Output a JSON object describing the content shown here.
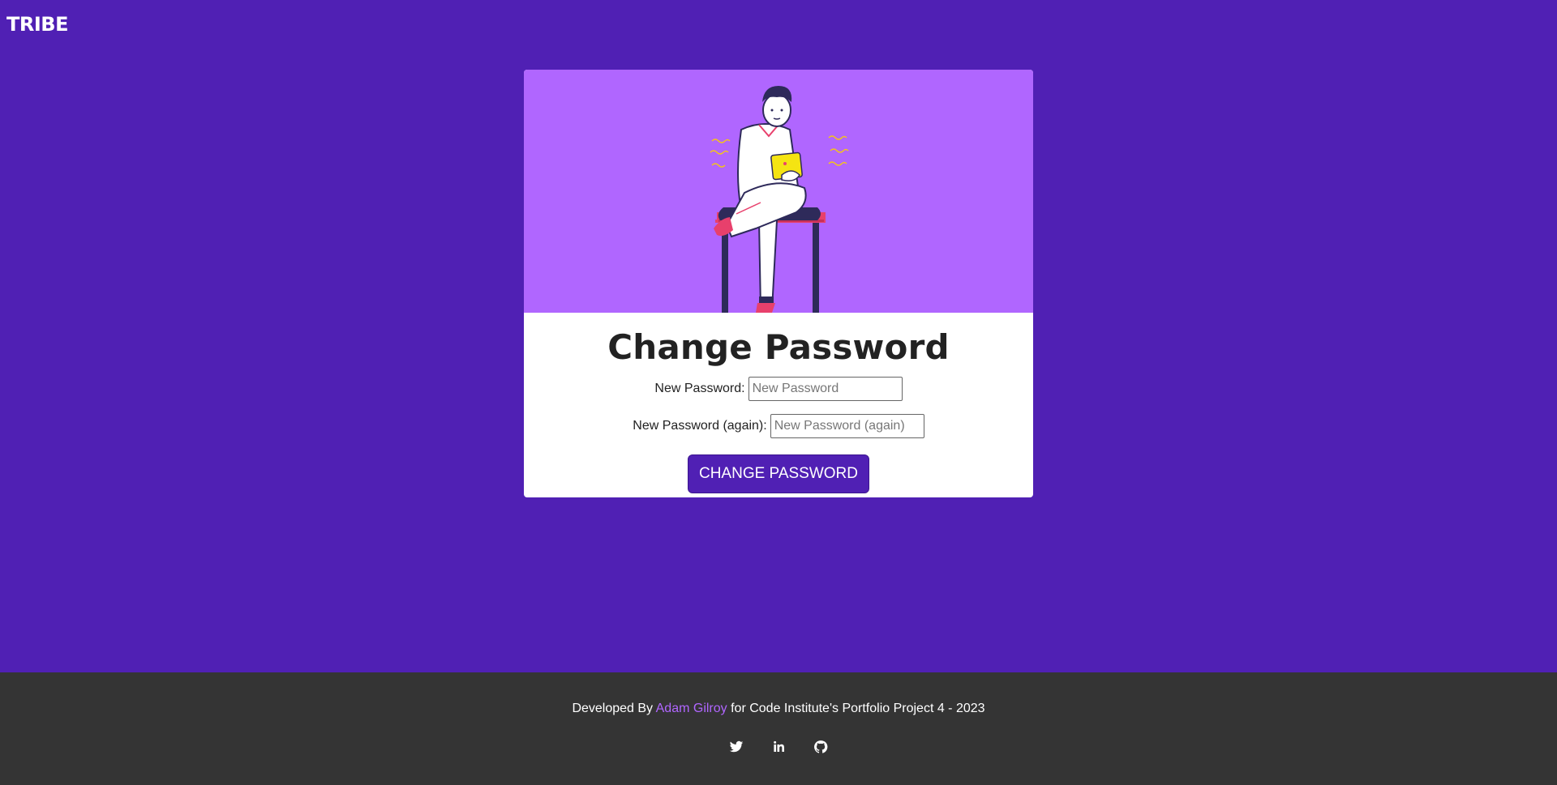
{
  "nav": {
    "brand": "TRIBE"
  },
  "form": {
    "title": "Change Password",
    "password1_label": "New Password:",
    "password1_placeholder": "New Password",
    "password2_label": "New Password (again):",
    "password2_placeholder": "New Password (again)",
    "submit_label": "CHANGE PASSWORD"
  },
  "footer": {
    "prefix": "Developed By",
    "author": "Adam Gilroy",
    "suffix": "for Code Institute's Portfolio Project 4 - 2023",
    "socials": [
      "twitter-icon",
      "linkedin-icon",
      "github-icon"
    ]
  },
  "colors": {
    "page_background": "#5020b4",
    "hero_background": "#b066ff",
    "footer_background": "#343434",
    "accent_link": "#b066ff",
    "button": "#5020b4"
  }
}
